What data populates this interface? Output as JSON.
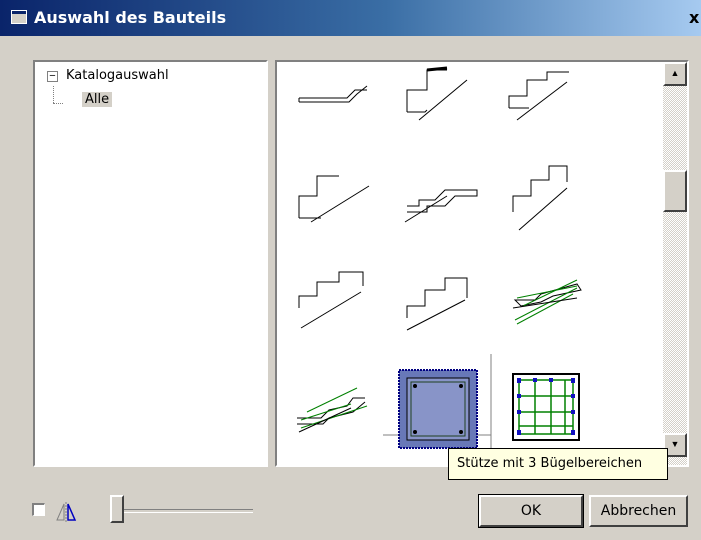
{
  "window": {
    "title": "Auswahl des Bauteils",
    "close_glyph": "x",
    "title_bar_colors": [
      "#0a246a",
      "#a6caf0"
    ]
  },
  "tree": {
    "root_label": "Katalogauswahl",
    "expander": "⊟",
    "child_label": "Alle"
  },
  "gallery": {
    "items": [
      "stair-profile-1",
      "stair-profile-2",
      "stair-profile-3",
      "stair-profile-4",
      "stair-profile-5",
      "stair-profile-6",
      "stair-profile-7",
      "stair-profile-8",
      "stair-profile-9-reinforced",
      "stair-profile-10-reinforced",
      "column-section-selected",
      "column-section-reinforced"
    ],
    "selected_item": "column-section-selected",
    "scroll_up_glyph": "▲",
    "scroll_down_glyph": "▼"
  },
  "tooltip": {
    "text": "Stütze mit 3 Bügelbereichen"
  },
  "footer": {
    "checkbox_checked": false,
    "mirror_icon": "mirror-icon",
    "slider_value": 0,
    "ok_label": "OK",
    "cancel_label": "Abbrechen"
  },
  "colors": {
    "dialog_bg": "#d4d0c8",
    "reinforcement_green": "#008000",
    "selection_blue": "#000080",
    "tooltip_bg": "#ffffe1"
  }
}
